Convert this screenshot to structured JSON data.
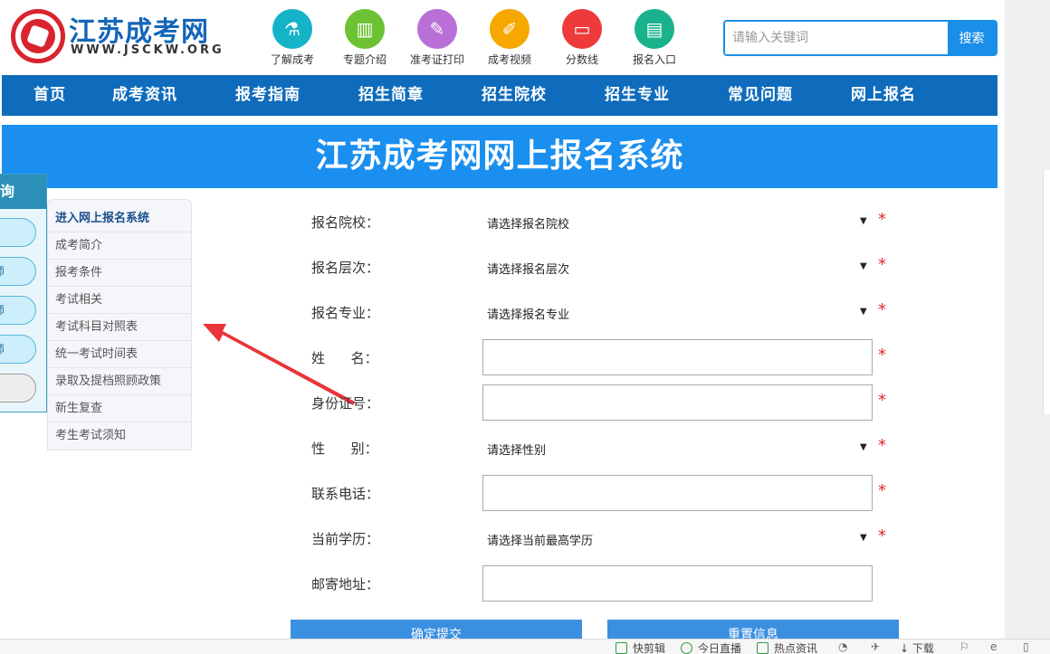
{
  "header": {
    "site_title": "江苏成考网",
    "site_domain": "WWW.JSCKW.ORG",
    "quick_links": [
      {
        "label": "了解成考",
        "color": "#14b3c8",
        "icon": "flask-icon",
        "glyph": "⚗"
      },
      {
        "label": "专题介绍",
        "color": "#6cc233",
        "icon": "building-icon",
        "glyph": "▥"
      },
      {
        "label": "准考证打印",
        "color": "#b86fd8",
        "icon": "ticket-icon",
        "glyph": "✎"
      },
      {
        "label": "成考视频",
        "color": "#f6a800",
        "icon": "video-icon",
        "glyph": "✐"
      },
      {
        "label": "分数线",
        "color": "#ee3a3a",
        "icon": "monitor-icon",
        "glyph": "▭"
      },
      {
        "label": "报名入口",
        "color": "#19b28c",
        "icon": "clipboard-icon",
        "glyph": "▤"
      }
    ],
    "search": {
      "placeholder": "请输入关键词",
      "button": "搜索"
    }
  },
  "nav": [
    "首页",
    "成考资讯",
    "报考指南",
    "招生简章",
    "招生院校",
    "招生专业",
    "常见问题",
    "网上报名"
  ],
  "banner_title": "江苏成考网网上报名系统",
  "float_panel": {
    "head": "询",
    "pills": [
      "",
      "师",
      "师",
      "师",
      ""
    ]
  },
  "side_menu": [
    "进入网上报名系统",
    "成考简介",
    "报考条件",
    "考试相关",
    "考试科目对照表",
    "统一考试时间表",
    "录取及提档照顾政策",
    "新生复查",
    "考生考试须知"
  ],
  "form": {
    "rows": [
      {
        "label": "报名院校：",
        "type": "select",
        "value": "请选择报名院校",
        "required": "*"
      },
      {
        "label": "报名层次：",
        "type": "select",
        "value": "请选择报名层次",
        "required": "*"
      },
      {
        "label": "报名专业：",
        "type": "select",
        "value": "请选择报名专业",
        "required": "*"
      },
      {
        "label": "姓      名：",
        "type": "input",
        "value": "",
        "required": "*"
      },
      {
        "label": "身份证号：",
        "type": "input",
        "value": "",
        "required": "*"
      },
      {
        "label": "性      别：",
        "type": "select",
        "value": "请选择性别",
        "required": "*"
      },
      {
        "label": "联系电话：",
        "type": "input",
        "value": "",
        "required": "*"
      },
      {
        "label": "当前学历：",
        "type": "select",
        "value": "请选择当前最高学历",
        "required": "*"
      },
      {
        "label": "邮寄地址：",
        "type": "input",
        "value": "",
        "required": ""
      }
    ],
    "submit": "确定提交",
    "reset": "重置信息"
  },
  "statusbar": {
    "items": [
      "快剪辑",
      "今日直播",
      "热点资讯"
    ],
    "download": "下载"
  },
  "colors": {
    "accent": "#1a8ff0",
    "nav": "#0f6cbc",
    "required": "#e0282e",
    "arrow": "#e8363a"
  }
}
